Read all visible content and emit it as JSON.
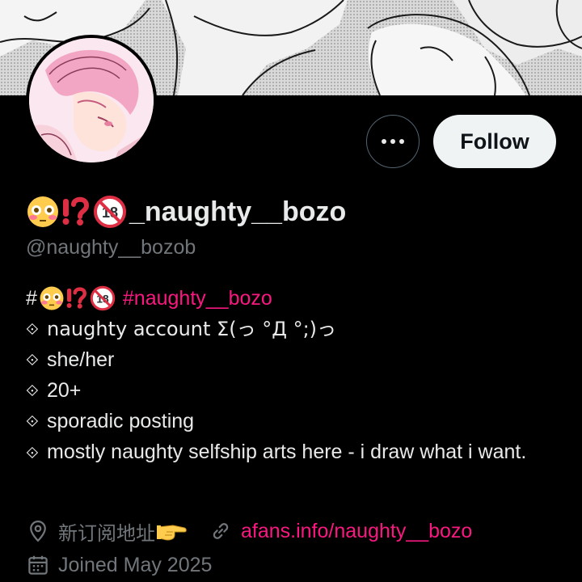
{
  "profile": {
    "display_name": "_naughty__bozo",
    "name_emojis": [
      "flushed-face-emoji",
      "exclamation-question-mark-emoji",
      "no-one-under-eighteen-emoji"
    ],
    "handle": "@naughty__bozob",
    "follow_label": "Follow",
    "more_icon": "more-horizontal-icon"
  },
  "bio": {
    "hashtag_prefix": "#",
    "hashtag": "#naughty__bozo",
    "lines": [
      "naughty account Σ(っ °Д °;)っ",
      "she/her",
      "20+",
      "sporadic posting",
      "mostly naughty selfship arts here - i draw what i want."
    ],
    "bullet_symbol": "⟐"
  },
  "meta": {
    "location": "新订阅地址",
    "location_emoji": "backhand-index-pointing-right-emoji",
    "website": "afans.info/naughty__bozo",
    "joined": "Joined May 2025"
  },
  "colors": {
    "background": "#000000",
    "primary_text": "#e7e9ea",
    "secondary_text": "#71767b",
    "accent": "#f91880",
    "follow_bg": "#eff3f4",
    "border": "#536471"
  }
}
